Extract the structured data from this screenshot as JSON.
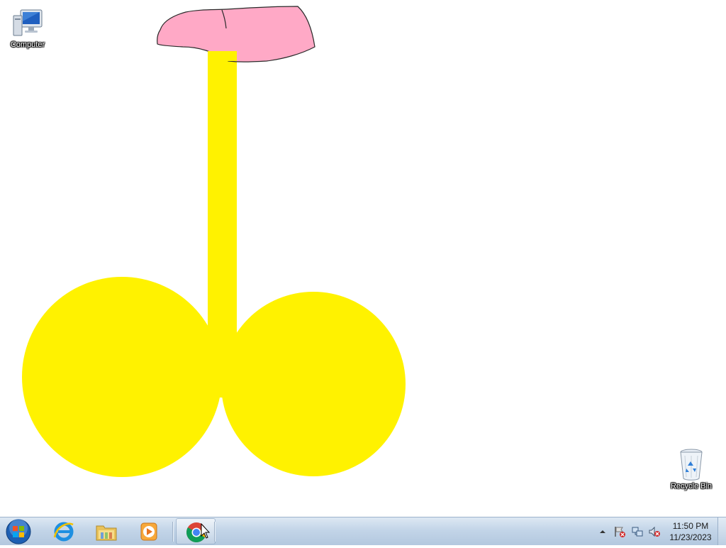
{
  "desktop": {
    "icons": [
      {
        "label": "Computer",
        "icon": "computer-icon"
      },
      {
        "label": "Recycle Bin",
        "icon": "recycle-bin-icon"
      }
    ],
    "drawing": {
      "colors": {
        "shape_fill": "#fff200",
        "hat_fill": "#ffa9c6",
        "hat_outline": "#2a2a2a"
      }
    }
  },
  "taskbar": {
    "start": {
      "icon": "windows-start-orb-icon"
    },
    "pinned": [
      {
        "name": "Internet Explorer",
        "icon": "internet-explorer-icon"
      },
      {
        "name": "Windows Explorer",
        "icon": "folder-library-icon"
      },
      {
        "name": "Windows Media Player",
        "icon": "media-player-icon"
      },
      {
        "name": "Google Chrome",
        "icon": "chrome-icon",
        "active": true
      }
    ],
    "tray": {
      "icons": [
        "show-hidden-icons-chevron",
        "action-center-flag-icon",
        "network-icon",
        "volume-muted-icon"
      ],
      "time": "11:50 PM",
      "date": "11/23/2023"
    },
    "colors": {
      "bar_top": "#dde8f3",
      "bar_bottom": "#b3c8df"
    }
  }
}
